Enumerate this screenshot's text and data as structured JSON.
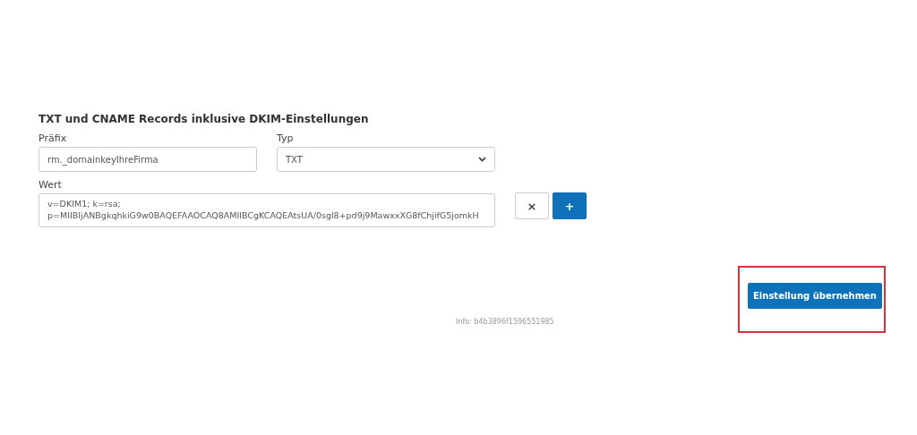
{
  "section": {
    "title": "TXT und CNAME Records inklusive DKIM-Einstellungen",
    "prefix": {
      "label": "Präfix",
      "value": "rm._domainkeyIhreFirma"
    },
    "type": {
      "label": "Typ",
      "value": "TXT"
    },
    "value_field": {
      "label": "Wert",
      "lines": [
        "v=DKIM1; k=rsa;",
        "p=MIIBIjANBgkqhkiG9w0BAQEFAAOCAQ8AMIIBCgKCAQEAtsUA/0sgl8+pd9j9MawxxXG8fChjifG5jomkH"
      ]
    },
    "remove_button": "×",
    "add_button": "+"
  },
  "footer": {
    "info": "Info: b4b3896f1596551985",
    "apply_button": "Einstellung übernehmen",
    "highlighted": true
  }
}
